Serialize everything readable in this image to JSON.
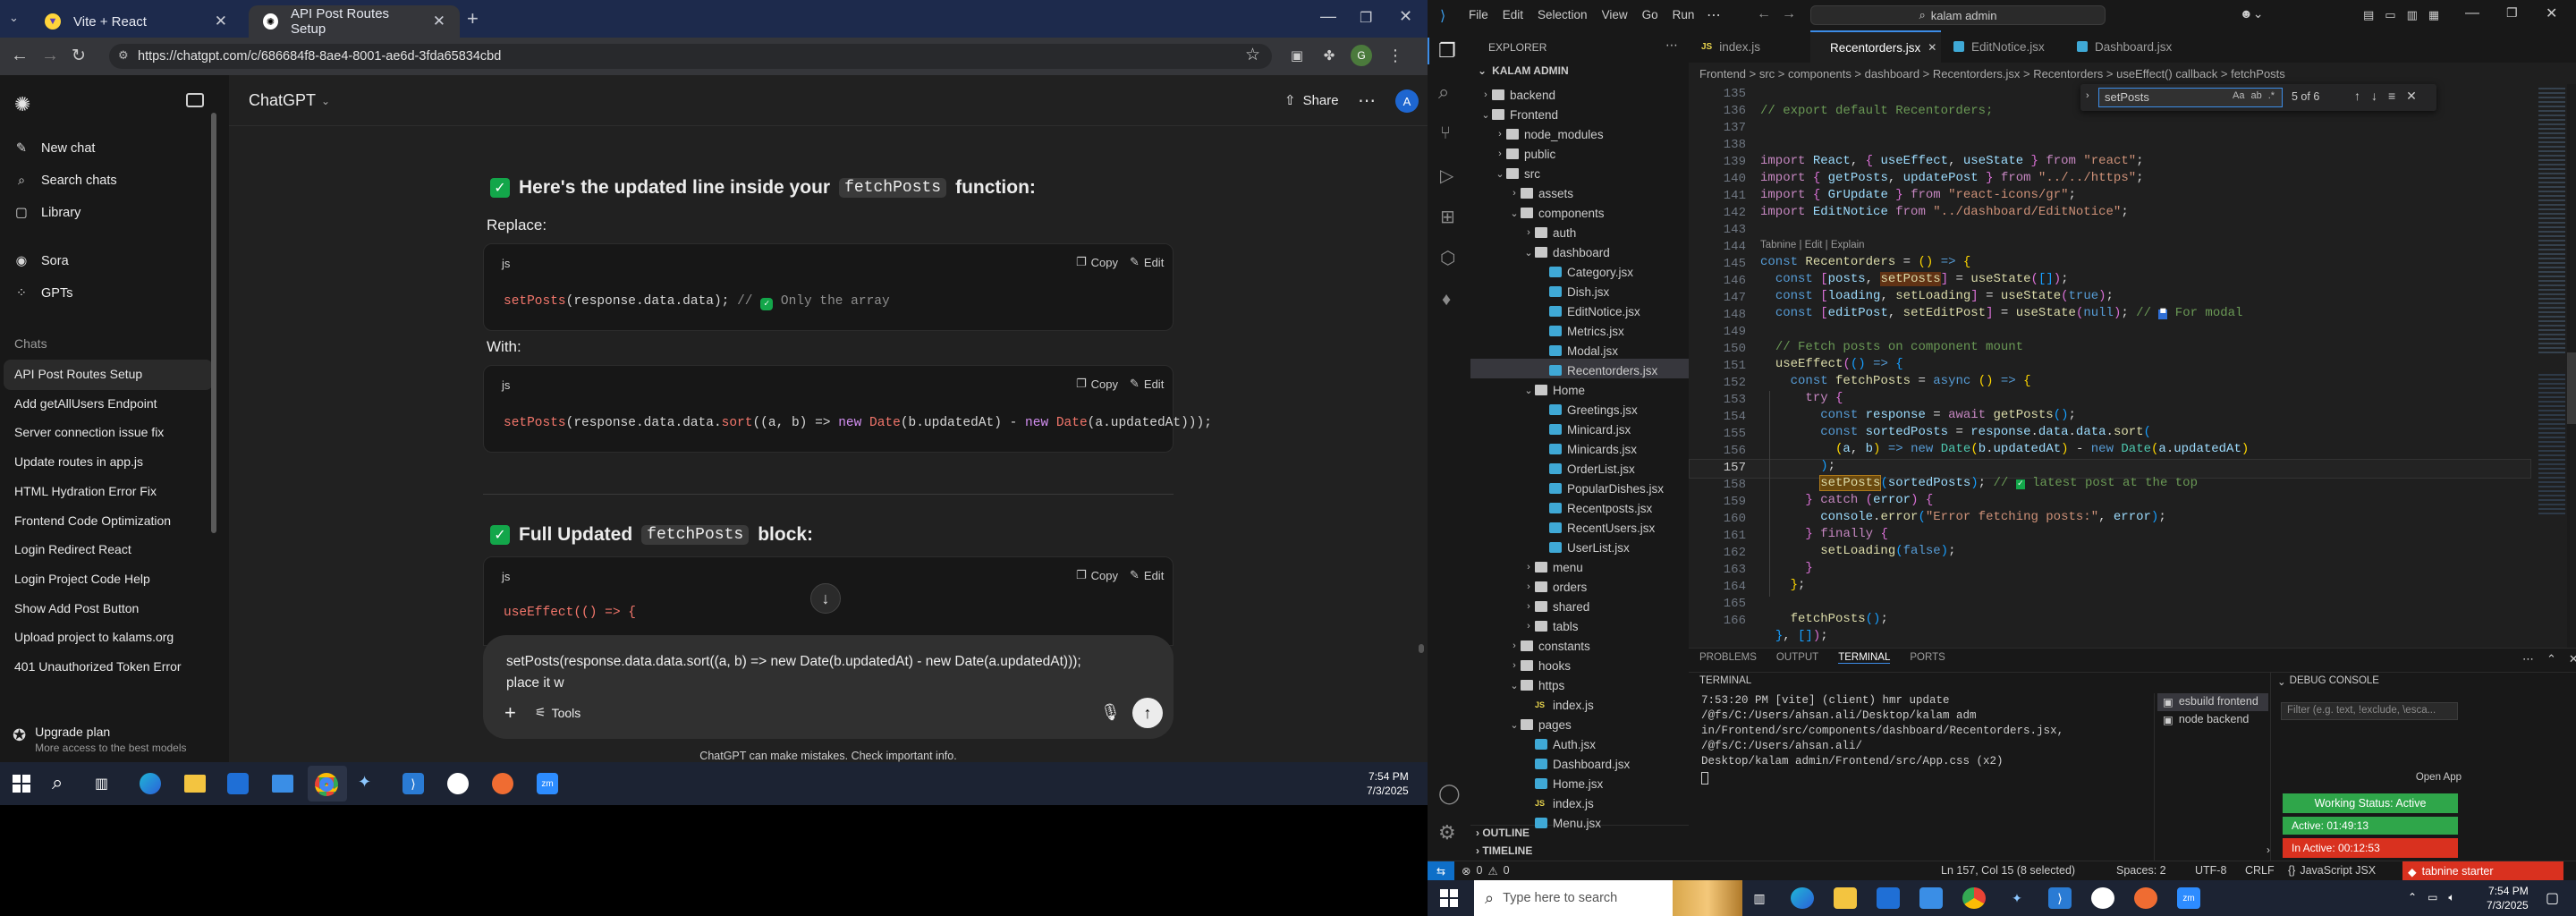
{
  "browser": {
    "tabs": [
      {
        "title": "Vite + React"
      },
      {
        "title": "API Post Routes Setup"
      }
    ],
    "url": "https://chatgpt.com/c/686684f8-8ae4-8001-ae6d-3fda65834cbd"
  },
  "chatgpt": {
    "sidebar": {
      "actions": [
        {
          "label": "New chat"
        },
        {
          "label": "Search chats"
        },
        {
          "label": "Library"
        }
      ],
      "tools": [
        {
          "label": "Sora"
        },
        {
          "label": "GPTs"
        }
      ],
      "chats_heading": "Chats",
      "chats": [
        "API Post Routes Setup",
        "Add getAllUsers Endpoint",
        "Server connection issue fix",
        "Update routes in app.js",
        "HTML Hydration Error Fix",
        "Frontend Code Optimization",
        "Login Redirect React",
        "Login Project Code Help",
        "Show Add Post Button",
        "Upload project to kalams.org",
        "401 Unauthorized Token Error"
      ],
      "upgrade": {
        "title": "Upgrade plan",
        "subtitle": "More access to the best models"
      }
    },
    "header": {
      "model": "ChatGPT",
      "share": "Share",
      "avatar": "A"
    },
    "content": {
      "heading1_pre": "Here's the updated line inside your",
      "heading1_code": "fetchPosts",
      "heading1_post": "function:",
      "replace_label": "Replace:",
      "with_label": "With:",
      "heading2_pre": "Full Updated",
      "heading2_code": "fetchPosts",
      "heading2_post": "block:",
      "lang": "js",
      "copy": "Copy",
      "edit": "Edit",
      "code1": {
        "fn": "setPosts",
        "args": "(response.data.data);",
        "comment": "// ",
        "comment_text": " Only the array"
      },
      "code2": {
        "fn": "setPosts",
        "a": "(response.data.data.",
        "sort": "sort",
        "b": "((a, b) => ",
        "new1": "new",
        "sp1": " ",
        "date1": "Date",
        "c": "(b.updatedAt) - ",
        "new2": "new",
        "sp2": " ",
        "date2": "Date",
        "d": "(a.updatedAt)));"
      },
      "code3": {
        "line1": "useEffect(() => {"
      }
    },
    "composer": {
      "line1": "setPosts(response.data.data.sort((a, b) => new Date(b.updatedAt) - new Date(a.updatedAt)));",
      "line2": "place it w",
      "tools": "Tools"
    },
    "disclaimer": "ChatGPT can make mistakes. Check important info."
  },
  "taskbar_left": {
    "time": "7:54 PM",
    "date": "7/3/2025"
  },
  "vscode": {
    "menu": [
      "File",
      "Edit",
      "Selection",
      "View",
      "Go",
      "Run"
    ],
    "search": "kalam admin",
    "explorer_title": "EXPLORER",
    "root": "KALAM ADMIN",
    "tree": [
      {
        "label": "backend",
        "depth": 0,
        "type": "folder",
        "open": false
      },
      {
        "label": "Frontend",
        "depth": 0,
        "type": "folder",
        "open": true
      },
      {
        "label": "node_modules",
        "depth": 1,
        "type": "folder",
        "open": false
      },
      {
        "label": "public",
        "depth": 1,
        "type": "folder",
        "open": false
      },
      {
        "label": "src",
        "depth": 1,
        "type": "folder",
        "open": true
      },
      {
        "label": "assets",
        "depth": 2,
        "type": "folder",
        "open": false
      },
      {
        "label": "components",
        "depth": 2,
        "type": "folder",
        "open": true
      },
      {
        "label": "auth",
        "depth": 3,
        "type": "folder",
        "open": false
      },
      {
        "label": "dashboard",
        "depth": 3,
        "type": "folder",
        "open": true
      },
      {
        "label": "Category.jsx",
        "depth": 4,
        "type": "file"
      },
      {
        "label": "Dish.jsx",
        "depth": 4,
        "type": "file"
      },
      {
        "label": "EditNotice.jsx",
        "depth": 4,
        "type": "file"
      },
      {
        "label": "Metrics.jsx",
        "depth": 4,
        "type": "file"
      },
      {
        "label": "Modal.jsx",
        "depth": 4,
        "type": "file"
      },
      {
        "label": "Recentorders.jsx",
        "depth": 4,
        "type": "file",
        "selected": true
      },
      {
        "label": "Home",
        "depth": 3,
        "type": "folder",
        "open": true
      },
      {
        "label": "Greetings.jsx",
        "depth": 4,
        "type": "file"
      },
      {
        "label": "Minicard.jsx",
        "depth": 4,
        "type": "file"
      },
      {
        "label": "Minicards.jsx",
        "depth": 4,
        "type": "file"
      },
      {
        "label": "OrderList.jsx",
        "depth": 4,
        "type": "file"
      },
      {
        "label": "PopularDishes.jsx",
        "depth": 4,
        "type": "file"
      },
      {
        "label": "Recentposts.jsx",
        "depth": 4,
        "type": "file"
      },
      {
        "label": "RecentUsers.jsx",
        "depth": 4,
        "type": "file"
      },
      {
        "label": "UserList.jsx",
        "depth": 4,
        "type": "file"
      },
      {
        "label": "menu",
        "depth": 3,
        "type": "folder",
        "open": false
      },
      {
        "label": "orders",
        "depth": 3,
        "type": "folder",
        "open": false
      },
      {
        "label": "shared",
        "depth": 3,
        "type": "folder",
        "open": false
      },
      {
        "label": "tabls",
        "depth": 3,
        "type": "folder",
        "open": false
      },
      {
        "label": "constants",
        "depth": 2,
        "type": "folder",
        "open": false
      },
      {
        "label": "hooks",
        "depth": 2,
        "type": "folder",
        "open": false
      },
      {
        "label": "https",
        "depth": 2,
        "type": "folder",
        "open": true
      },
      {
        "label": "index.js",
        "depth": 3,
        "type": "jsfile"
      },
      {
        "label": "pages",
        "depth": 2,
        "type": "folder",
        "open": true
      },
      {
        "label": "Auth.jsx",
        "depth": 3,
        "type": "file"
      },
      {
        "label": "Dashboard.jsx",
        "depth": 3,
        "type": "file"
      },
      {
        "label": "Home.jsx",
        "depth": 3,
        "type": "file"
      },
      {
        "label": "index.js",
        "depth": 3,
        "type": "jsfile"
      },
      {
        "label": "Menu.jsx",
        "depth": 3,
        "type": "file"
      }
    ],
    "outline": "OUTLINE",
    "timeline": "TIMELINE",
    "editor_tabs": [
      {
        "label": "index.js",
        "icon": "JS"
      },
      {
        "label": "Recentorders.jsx",
        "icon": "R",
        "active": true
      },
      {
        "label": "EditNotice.jsx",
        "icon": "R"
      },
      {
        "label": "Dashboard.jsx",
        "icon": "R"
      }
    ],
    "breadcrumb": "Frontend > src > components > dashboard > Recentorders.jsx > Recentorders > useEffect() callback > fetchPosts",
    "find": {
      "query": "setPosts",
      "result": "5 of 6"
    },
    "codelens": "Tabnine | Edit | Explain",
    "line_numbers": [
      "135",
      "136",
      "137",
      "138",
      "139",
      "140",
      "141",
      "142",
      "143",
      "144",
      "145",
      "146",
      "147",
      "148",
      "149",
      "150",
      "151",
      "152",
      "153",
      "154",
      "155",
      "156",
      "157",
      "158",
      "159",
      "160",
      "161",
      "162",
      "163",
      "164",
      "165",
      "166"
    ],
    "panel": {
      "tabs": [
        "PROBLEMS",
        "OUTPUT",
        "TERMINAL",
        "PORTS"
      ],
      "terminal_title": "TERMINAL",
      "lines": [
        "7:53:20 PM [vite] (client) hmr update /@fs/C:/Users/ahsan.ali/Desktop/kalam adm",
        "in/Frontend/src/components/dashboard/Recentorders.jsx, /@fs/C:/Users/ahsan.ali/",
        "Desktop/kalam admin/Frontend/src/App.css (x2)"
      ],
      "procs": [
        "esbuild frontend",
        "node backend"
      ],
      "debug_title": "DEBUG CONSOLE",
      "filter_placeholder": "Filter (e.g. text, !exclude, \\esca...",
      "open_app": "Open App",
      "working": "Working Status: Active",
      "active_time": "Active: 01:49:13",
      "inactive_time": "In Active: 00:12:53"
    },
    "status": {
      "errors": "0",
      "warnings": "0",
      "position": "Ln 157, Col 15 (8 selected)",
      "spaces": "Spaces: 2",
      "encoding": "UTF-8",
      "eol": "CRLF",
      "language": "JavaScript JSX",
      "tabnine": "tabnine starter"
    }
  },
  "taskbar_right": {
    "search_placeholder": "Type here to search",
    "time": "7:54 PM",
    "date": "7/3/2025"
  }
}
